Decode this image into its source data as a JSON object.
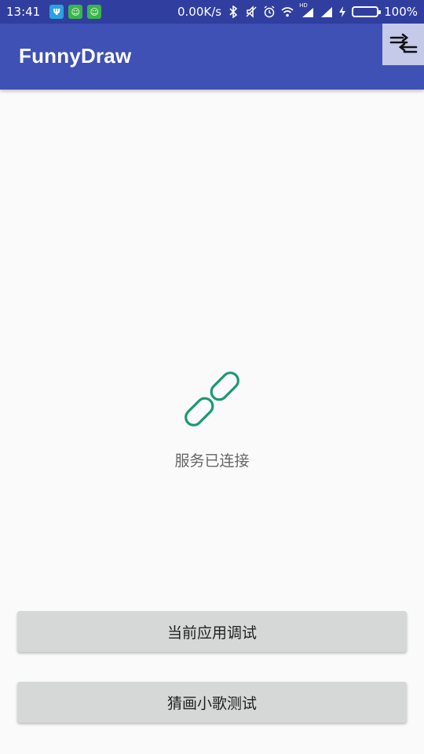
{
  "status_bar": {
    "time": "13:41",
    "net_speed": "0.00K/s",
    "signal_label": "HD",
    "battery_percent": "100%",
    "battery_level": 1.0,
    "apps": [
      {
        "icon": "usb-icon",
        "color": "#29a3e0",
        "glyph": "Ψ"
      },
      {
        "icon": "android-icon",
        "color": "#39b54a",
        "glyph": "☺"
      },
      {
        "icon": "android-icon",
        "color": "#39b54a",
        "glyph": "☺"
      }
    ]
  },
  "appbar": {
    "title": "FunnyDraw",
    "action_icon": "swap-arrows-icon",
    "color": "#3f51b5"
  },
  "main": {
    "status_icon": "link-icon",
    "status_text": "服务已连接",
    "accent": "#1a9a72"
  },
  "buttons": {
    "debug_label": "当前应用调试",
    "guess_label": "猜画小歌测试"
  }
}
